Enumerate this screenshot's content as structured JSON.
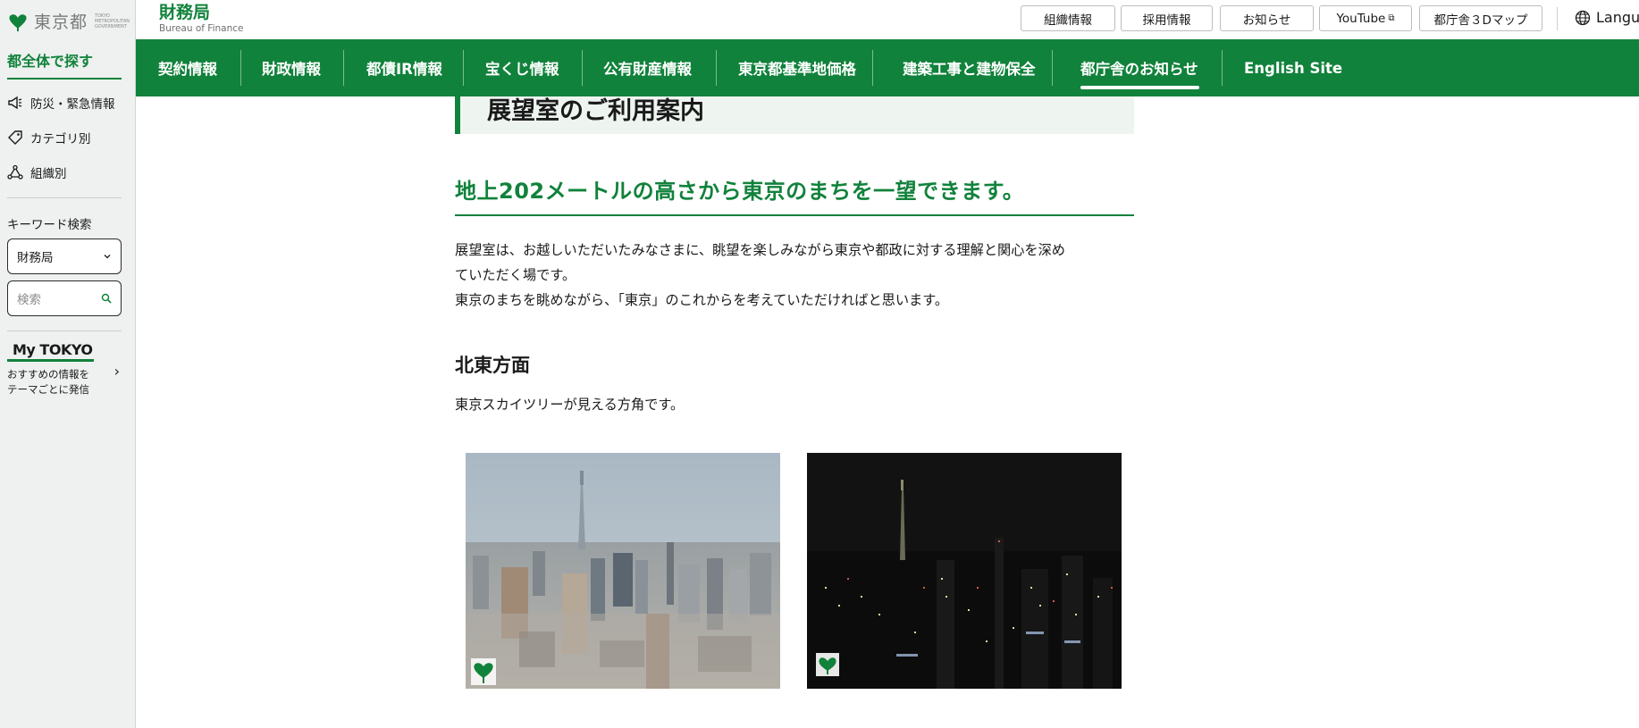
{
  "sidebar": {
    "logo_text": "東京都",
    "logo_sub": "TOKYO METROPOLITAN GOVERNMENT",
    "search_all": "都全体で探す",
    "links": [
      {
        "label": "防災・緊急情報",
        "icon": "megaphone-icon"
      },
      {
        "label": "カテゴリ別",
        "icon": "tag-icon"
      },
      {
        "label": "組織別",
        "icon": "org-chart-icon"
      }
    ],
    "keyword_label": "キーワード検索",
    "select_value": "財務局",
    "search_placeholder": "検索",
    "mytokyo": {
      "logo": "My TOKYO",
      "desc_line1": "おすすめの情報を",
      "desc_line2": "テーマごとに発信"
    }
  },
  "header": {
    "bureau_name": "財務局",
    "bureau_en": "Bureau of Finance",
    "utility": [
      "組織情報",
      "採用情報",
      "お知らせ",
      "YouTube",
      "都庁舎３Dマップ"
    ],
    "language": "Language"
  },
  "nav": {
    "items": [
      "契約情報",
      "財政情報",
      "都債IR情報",
      "宝くじ情報",
      "公有財産情報",
      "東京都基準地価格",
      "建築工事と建物保全",
      "都庁舎のお知らせ",
      "English Site"
    ],
    "active": "都庁舎のお知らせ"
  },
  "main": {
    "page_title": "展望室のご利用案内",
    "lead": "地上202メートルの高さから東京のまちを一望できます。",
    "para_line1": "展望室は、お越しいただいたみなさまに、眺望を楽しみながら東京や都政に対する理解と関心を深め",
    "para_line2": "ていただく場です。",
    "para_line3": "東京のまちを眺めながら、「東京」のこれからを考えていただければと思います。",
    "section_title": "北東方面",
    "section_desc": "東京スカイツリーが見える方角です。"
  },
  "colors": {
    "brand_green": "#11823b",
    "sidebar_bg": "#eef1ef",
    "title_bg": "#eef5f0"
  }
}
